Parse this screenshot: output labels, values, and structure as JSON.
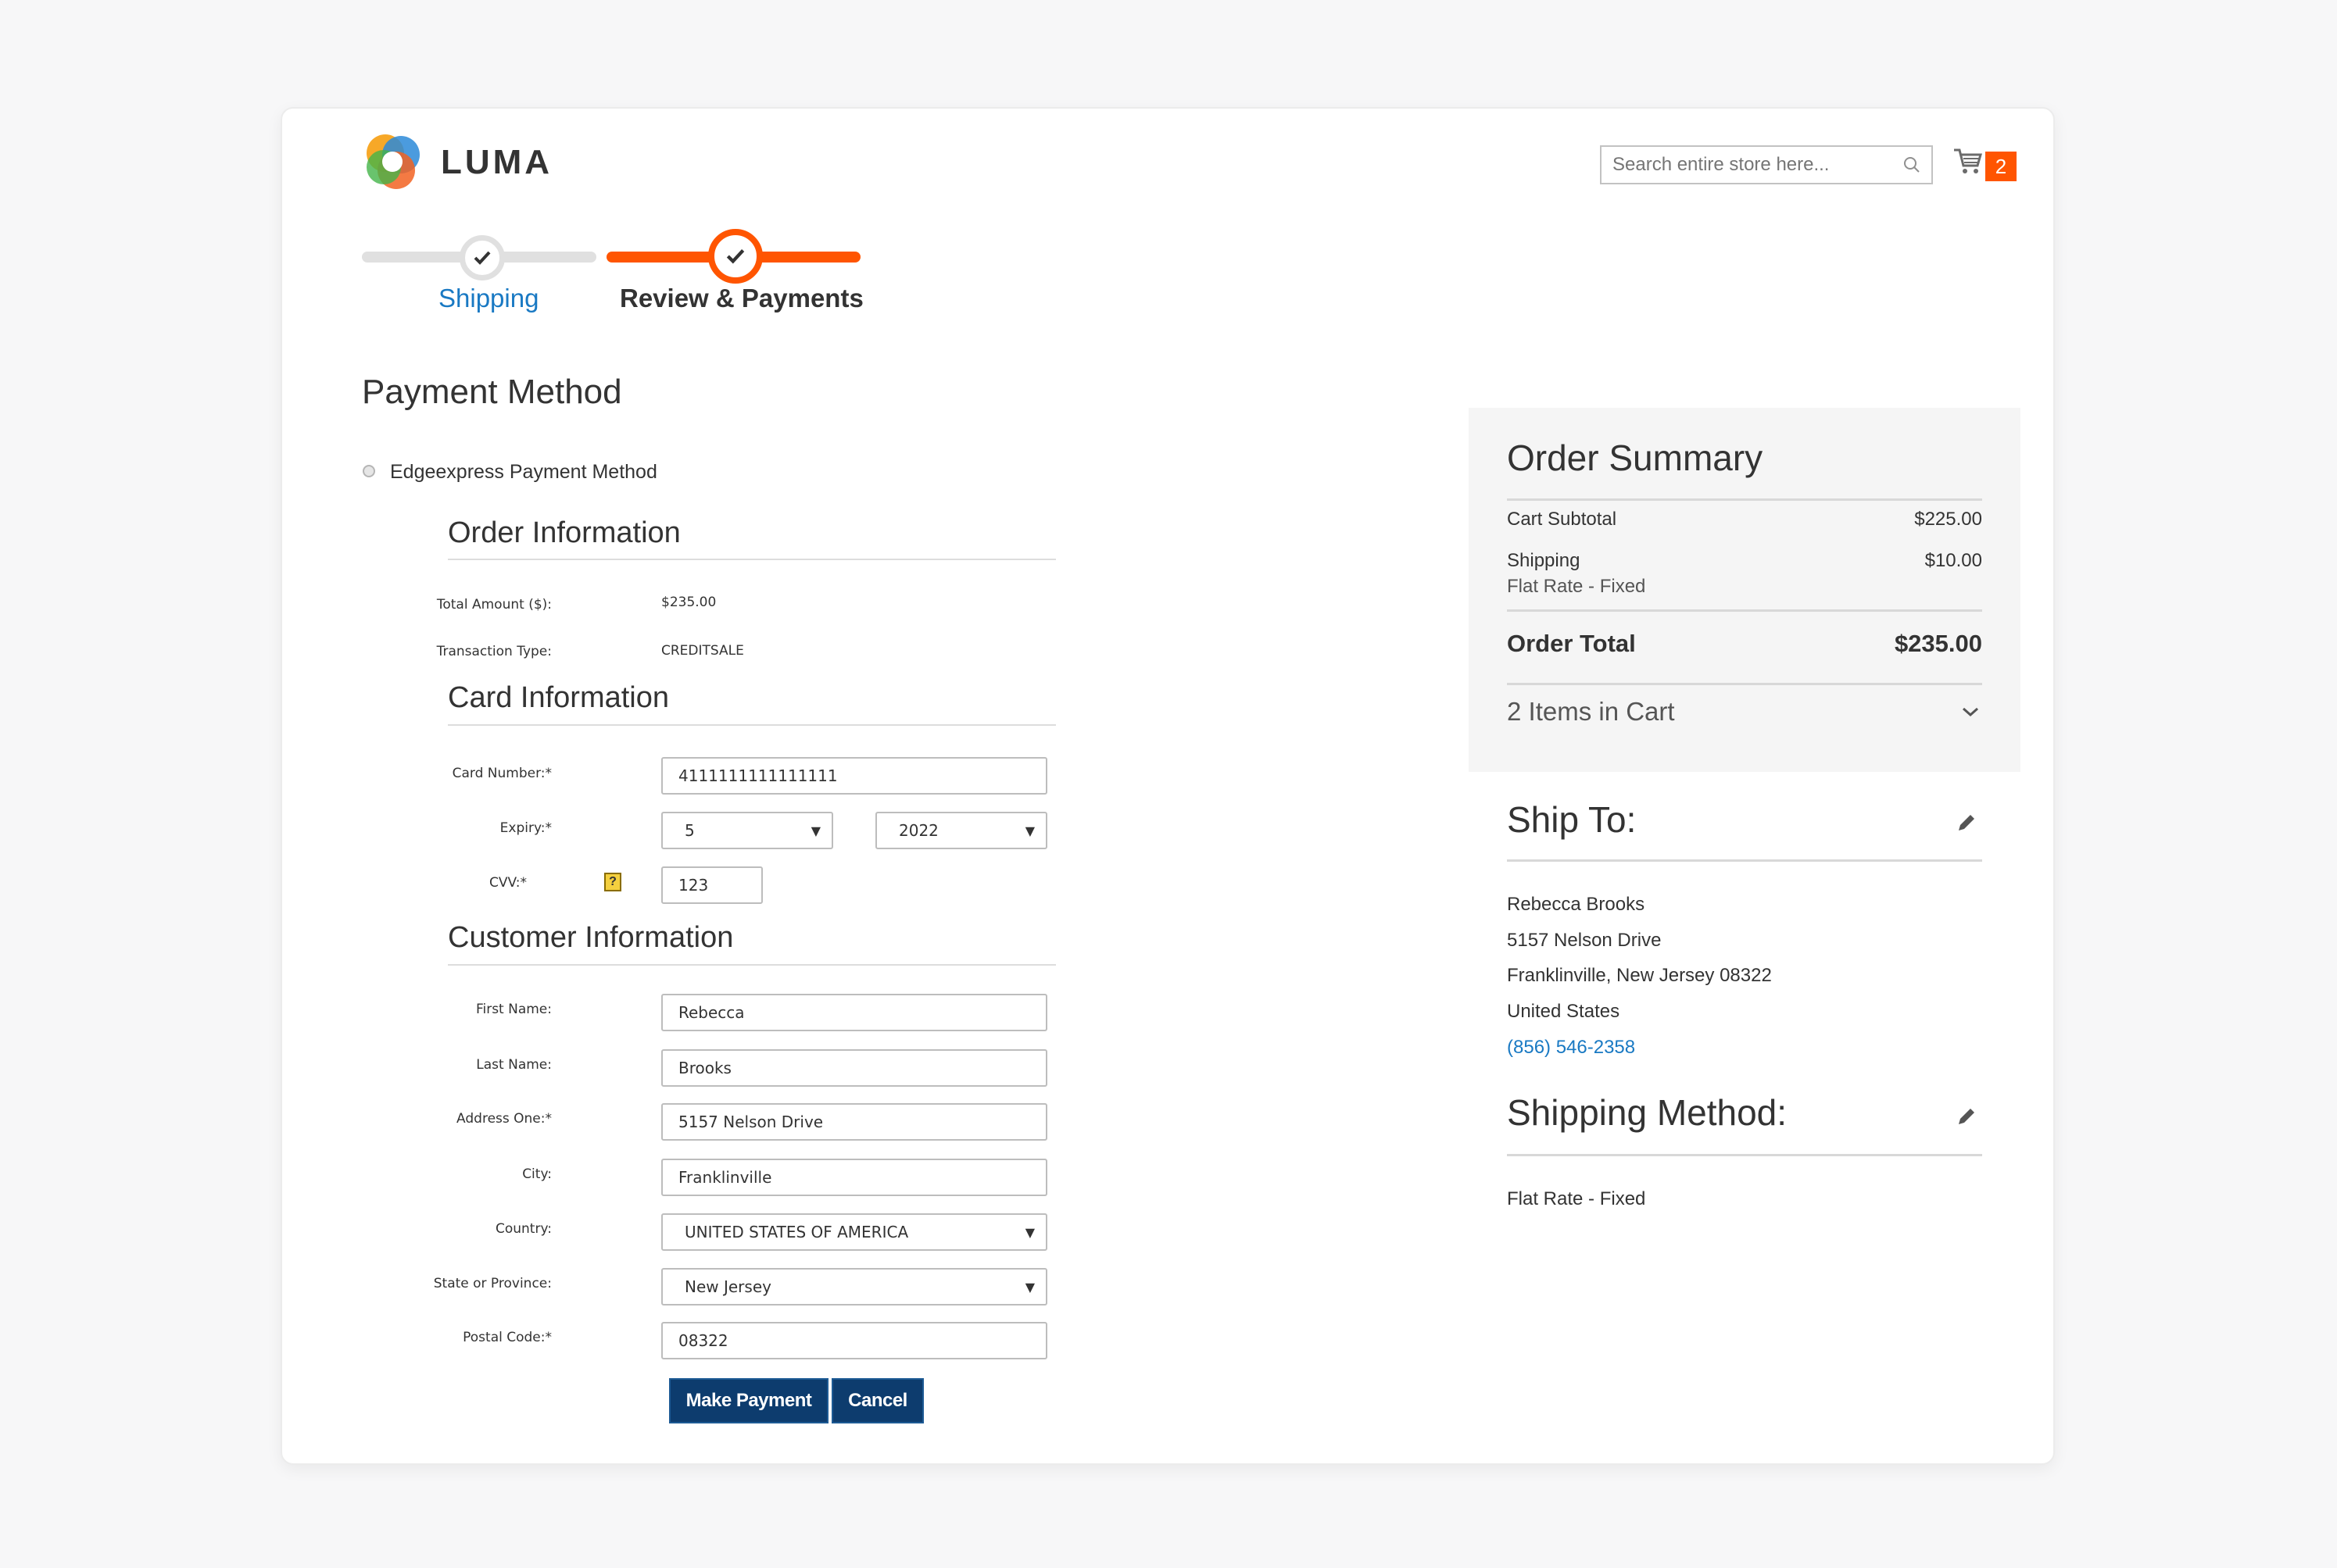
{
  "header": {
    "logo_text": "LUMA",
    "search_placeholder": "Search entire store here...",
    "cart_count": "2",
    "accent_color": "#ff5501"
  },
  "progress": {
    "steps": [
      {
        "label": "Shipping",
        "status": "complete"
      },
      {
        "label": "Review & Payments",
        "status": "active"
      }
    ]
  },
  "payment": {
    "title": "Payment Method",
    "method_label": "Edgeexpress Payment Method",
    "order_info": {
      "title": "Order Information",
      "total_label": "Total Amount ($):",
      "total_value": "$235.00",
      "type_label": "Transaction Type:",
      "type_value": "CREDITSALE"
    },
    "card_info": {
      "title": "Card Information",
      "card_number_label": "Card Number:*",
      "card_number_value": "4111111111111111",
      "expiry_label": "Expiry:*",
      "expiry_month": "5",
      "expiry_year": "2022",
      "cvv_label": "CVV:*",
      "cvv_help": "?",
      "cvv_value": "123"
    },
    "customer_info": {
      "title": "Customer Information",
      "first_name_label": "First Name:",
      "first_name": "Rebecca",
      "last_name_label": "Last Name:",
      "last_name": "Brooks",
      "address_label": "Address One:*",
      "address": "5157 Nelson Drive",
      "city_label": "City:",
      "city": "Franklinville",
      "country_label": "Country:",
      "country": "UNITED STATES OF AMERICA",
      "state_label": "State or Province:",
      "state": "New Jersey",
      "postal_label": "Postal Code:*",
      "postal": "08322"
    },
    "buttons": {
      "pay": "Make Payment",
      "cancel": "Cancel"
    }
  },
  "summary": {
    "title": "Order Summary",
    "subtotal_label": "Cart Subtotal",
    "subtotal_value": "$225.00",
    "shipping_label": "Shipping",
    "shipping_sub": "Flat Rate - Fixed",
    "shipping_value": "$10.00",
    "total_label": "Order Total",
    "total_value": "$235.00",
    "items_label": "2 Items in Cart"
  },
  "ship_to": {
    "title": "Ship To:",
    "name": "Rebecca Brooks",
    "street": "5157 Nelson Drive",
    "city_line": "Franklinville, New Jersey 08322",
    "country": "United States",
    "phone": "(856) 546-2358"
  },
  "shipping_method": {
    "title": "Shipping Method:",
    "value": "Flat Rate - Fixed"
  }
}
